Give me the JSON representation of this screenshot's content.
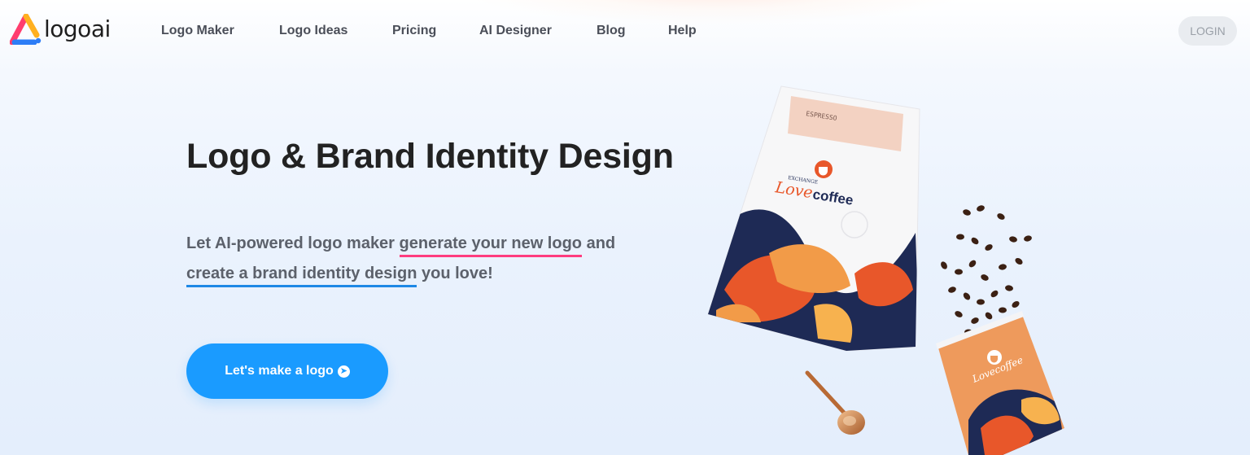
{
  "brand": {
    "name": "logoai"
  },
  "nav": {
    "items": [
      {
        "label": "Logo Maker"
      },
      {
        "label": "Logo Ideas"
      },
      {
        "label": "Pricing"
      },
      {
        "label": "AI Designer"
      },
      {
        "label": "Blog"
      },
      {
        "label": "Help"
      }
    ],
    "login_label": "LOGIN"
  },
  "hero": {
    "title": "Logo & Brand Identity Design",
    "desc_part1": "Let AI-powered logo maker ",
    "desc_highlight1": "generate your new logo",
    "desc_part2": " and ",
    "desc_highlight2": "create a brand identity design",
    "desc_part3": " you love!",
    "cta_label": "Let's make a logo",
    "cta_icon": "arrow-circle-right-icon"
  },
  "mockup": {
    "bag_label": "ESPRESSO",
    "bag_brand_top": "EXCHANGE",
    "bag_brand_love": "Love",
    "bag_brand_coffee": "coffee",
    "cup_brand": "Lovecoffee"
  },
  "colors": {
    "accent_blue": "#1a9bff",
    "underline_pink": "#ff3d7f",
    "underline_blue": "#1e88e5",
    "brand_orange": "#e8572a",
    "navy": "#1e2a55"
  }
}
